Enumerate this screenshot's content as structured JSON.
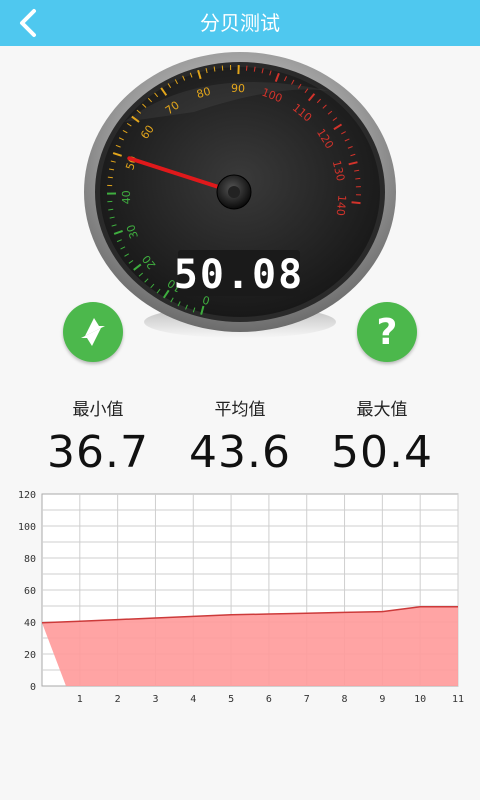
{
  "header": {
    "title": "分贝测试"
  },
  "meter": {
    "reading": "50.08",
    "dial_ticks": [
      "0",
      "10",
      "20",
      "30",
      "40",
      "50",
      "60",
      "70",
      "80",
      "90",
      "100",
      "110",
      "120",
      "130",
      "140"
    ],
    "needle_value": 50
  },
  "buttons": {
    "reset_icon": "refresh-arrows-icon",
    "help_icon": "question-icon",
    "help_glyph": "?"
  },
  "stats": {
    "min_label": "最小值",
    "min_value": "36.7",
    "avg_label": "平均值",
    "avg_value": "43.6",
    "max_label": "最大值",
    "max_value": "50.4"
  },
  "colors": {
    "header": "#4fc8ef",
    "button_green": "#4cb84c",
    "chart_fill": "#ff9a9a",
    "chart_line": "#cc3a3a"
  },
  "chart_data": {
    "type": "area",
    "x": [
      0,
      1,
      2,
      3,
      4,
      5,
      6,
      7,
      8,
      9,
      10,
      11
    ],
    "values": [
      39.5,
      40.5,
      41.5,
      42.5,
      43.5,
      44.5,
      45,
      45.5,
      46,
      46.5,
      49.5,
      49.5
    ],
    "xtick_labels": [
      "1",
      "2",
      "3",
      "4",
      "5",
      "6",
      "7",
      "8",
      "9",
      "10",
      "11"
    ],
    "ytick_labels": [
      "0",
      "20",
      "40",
      "60",
      "80",
      "100",
      "120"
    ],
    "ylim": [
      0,
      120
    ],
    "grid": true
  }
}
